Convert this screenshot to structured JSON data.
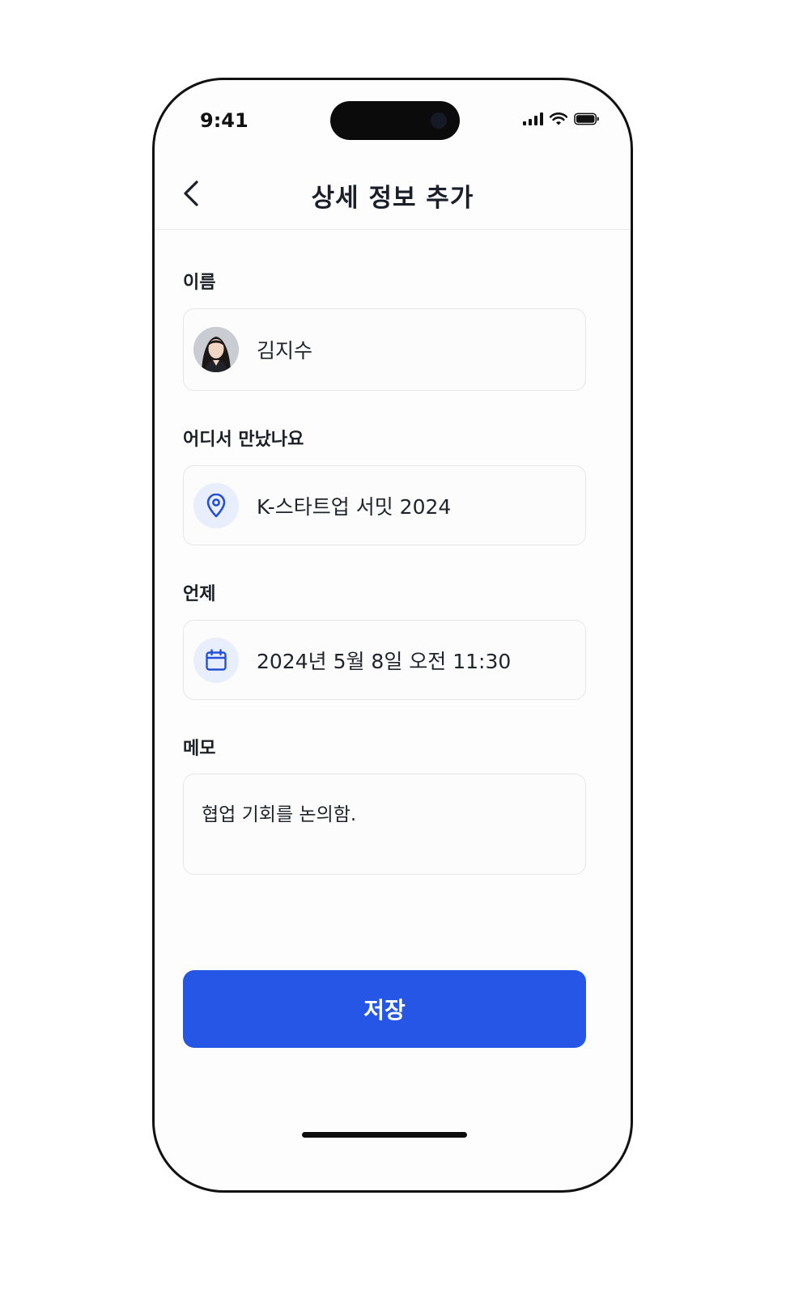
{
  "status_bar": {
    "time": "9:41",
    "icons": [
      "cellular-signal-icon",
      "wifi-icon",
      "battery-icon"
    ]
  },
  "header": {
    "back_icon": "chevron-left-icon",
    "title": "상세 정보 추가"
  },
  "form": {
    "name": {
      "label": "이름",
      "value": "김지수",
      "icon": "avatar-photo"
    },
    "where": {
      "label": "어디서 만났나요",
      "value": "K-스타트업 서밋 2024",
      "icon": "map-pin-icon"
    },
    "when": {
      "label": "언제",
      "value": "2024년 5월 8일 오전 11:30",
      "icon": "calendar-icon"
    },
    "memo": {
      "label": "메모",
      "value": "협업 기회를 논의함."
    }
  },
  "actions": {
    "save_label": "저장"
  },
  "colors": {
    "accent": "#2656e6",
    "icon_bg": "#e8eefb",
    "icon_stroke": "#2450d8",
    "text": "#1c1f26",
    "field_border": "#e4e6ea"
  }
}
